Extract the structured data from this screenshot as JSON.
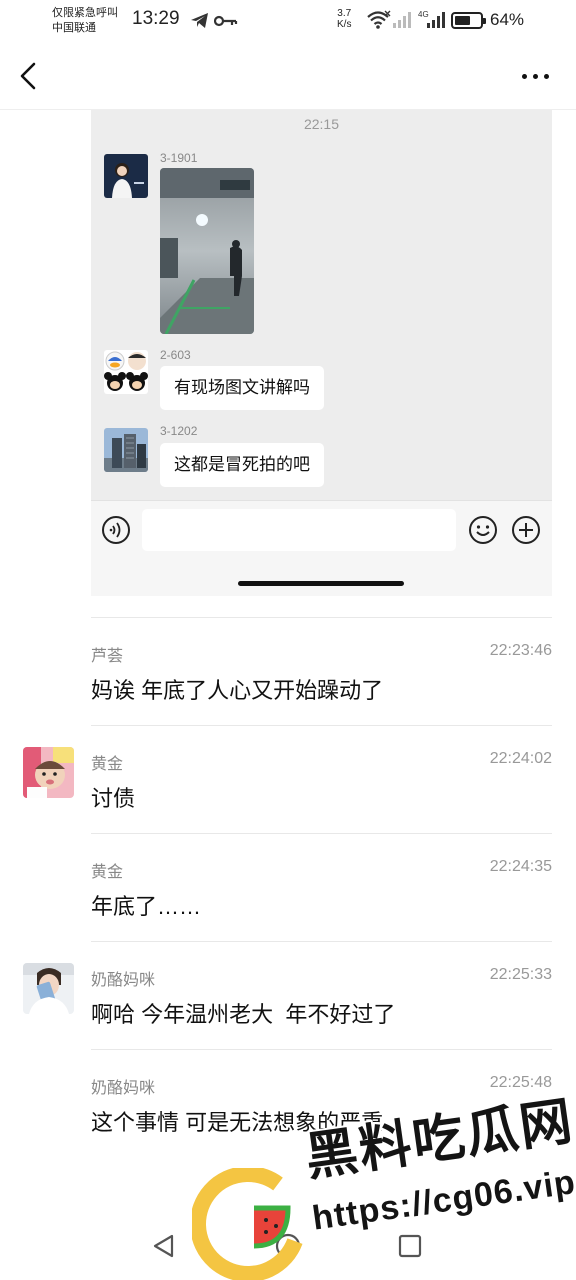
{
  "status_bar": {
    "carrier_line1": "仅限紧急呼叫",
    "carrier_line2": "中国联通",
    "time": "13:29",
    "net_speed_value": "3.7",
    "net_speed_unit": "K/s",
    "network_type": "4G",
    "battery": "64%",
    "battery_level": 0.64
  },
  "embedded_chat": {
    "time": "22:15",
    "messages": [
      {
        "sender": "3-1901",
        "type": "image"
      },
      {
        "sender": "2-603",
        "text": "有现场图文讲解吗"
      },
      {
        "sender": "3-1202",
        "text": "这都是冒死拍的吧"
      }
    ]
  },
  "messages": [
    {
      "sender": "芦荟",
      "time": "22:23:46",
      "text": "妈诶 年底了人心又开始躁动了",
      "avatar": ""
    },
    {
      "sender": "黄金",
      "time": "22:24:02",
      "text": "讨债",
      "avatar": "baby-photo"
    },
    {
      "sender": "黄金",
      "time": "22:24:35",
      "text": "年底了……",
      "avatar": ""
    },
    {
      "sender": "奶酪妈咪",
      "time": "22:25:33",
      "text": "啊哈 今年温州老大  年不好过了",
      "avatar": "selfie-photo"
    },
    {
      "sender": "奶酪妈咪",
      "time": "22:25:48",
      "text": "这个事情 可是无法想象的严重",
      "avatar": ""
    }
  ],
  "watermark": {
    "title": "黑料吃瓜网",
    "url": "https://cg06.vip"
  },
  "colors": {
    "accent_watermark_yellow": "#f4c542",
    "watermark_green": "#3cb043",
    "watermark_red": "#e8433a"
  }
}
